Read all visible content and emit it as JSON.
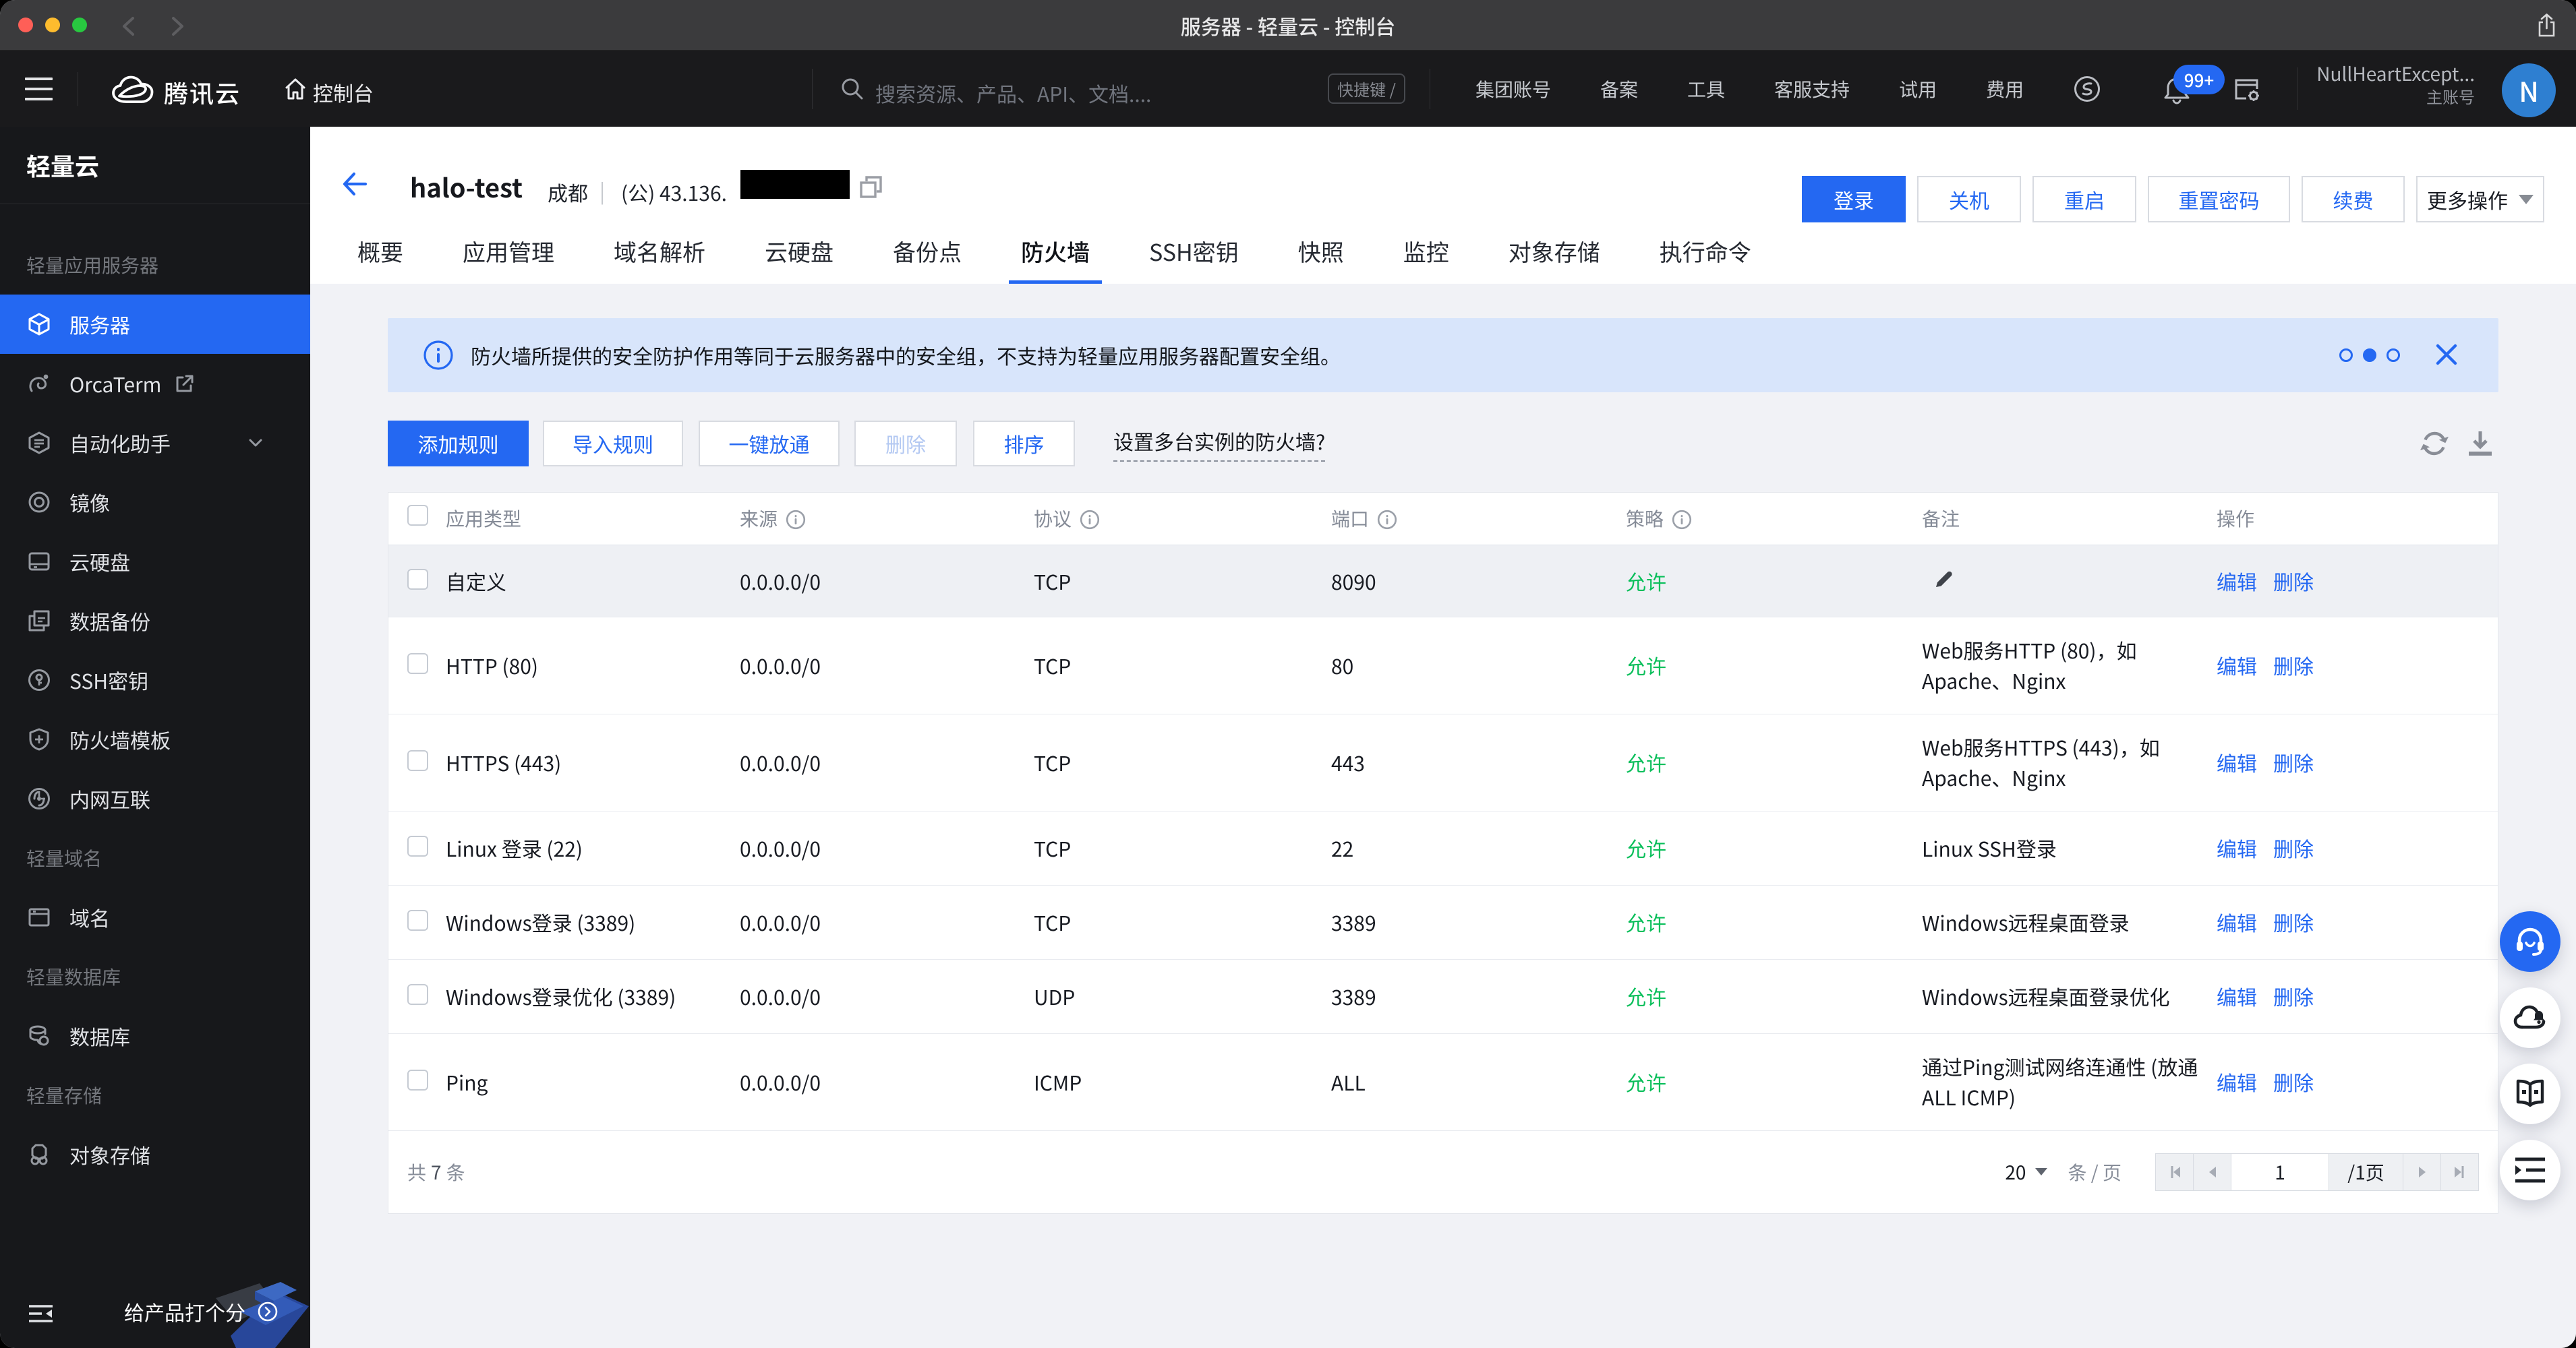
{
  "colors": {
    "accent_blue": "#2468f2",
    "success_green": "#0abf5b",
    "banner_bg": "#d8e5fb",
    "sidebar_bg": "#17181b",
    "navbar_bg": "#1a1a1c",
    "titlebar_bg": "#3b3b3d",
    "content_bg": "#f1f2f6",
    "avatar_bg": "#2e7fd1"
  },
  "titlebar": {
    "title": "服务器 - 轻量云 - 控制台"
  },
  "navbar": {
    "brand": "腾讯云",
    "console": "控制台",
    "search_placeholder": "搜索资源、产品、API、文档....",
    "shortcut_label": "快捷键 /",
    "items": [
      {
        "label": "集团账号"
      },
      {
        "label": "备案"
      },
      {
        "label": "工具"
      },
      {
        "label": "客服支持"
      },
      {
        "label": "试用"
      },
      {
        "label": "费用"
      }
    ],
    "notification_badge": "99+",
    "username": "NullHeartExcept...",
    "account_type": "主账号",
    "avatar_letter": "N"
  },
  "sidebar": {
    "title": "轻量云",
    "sections": [
      {
        "label": "轻量应用服务器",
        "items": [
          {
            "label": "服务器",
            "icon": "server-icon",
            "active": true
          },
          {
            "label": "OrcaTerm",
            "icon": "orcaterm-icon",
            "external": true
          },
          {
            "label": "自动化助手",
            "icon": "automation-icon",
            "chevron": true
          },
          {
            "label": "镜像",
            "icon": "image-icon"
          },
          {
            "label": "云硬盘",
            "icon": "clouddisk-icon"
          },
          {
            "label": "数据备份",
            "icon": "backup-icon"
          },
          {
            "label": "SSH密钥",
            "icon": "sshkey-icon"
          },
          {
            "label": "防火墙模板",
            "icon": "firewall-template-icon"
          },
          {
            "label": "内网互联",
            "icon": "intranet-icon"
          }
        ]
      },
      {
        "label": "轻量域名",
        "items": [
          {
            "label": "域名",
            "icon": "domain-icon"
          }
        ]
      },
      {
        "label": "轻量数据库",
        "items": [
          {
            "label": "数据库",
            "icon": "database-icon"
          }
        ]
      },
      {
        "label": "轻量存储",
        "items": [
          {
            "label": "对象存储",
            "icon": "storage-icon"
          }
        ]
      }
    ],
    "rate_label": "给产品打个分"
  },
  "header": {
    "instance_name": "halo-test",
    "region": "成都",
    "separator": "|",
    "ip_label": "(公) 43.136.",
    "actions": [
      {
        "label": "登录",
        "primary": true
      },
      {
        "label": "关机"
      },
      {
        "label": "重启"
      },
      {
        "label": "重置密码"
      },
      {
        "label": "续费"
      }
    ],
    "more_label": "更多操作"
  },
  "tabs": [
    {
      "label": "概要"
    },
    {
      "label": "应用管理"
    },
    {
      "label": "域名解析"
    },
    {
      "label": "云硬盘"
    },
    {
      "label": "备份点"
    },
    {
      "label": "防火墙",
      "active": true
    },
    {
      "label": "SSH密钥"
    },
    {
      "label": "快照"
    },
    {
      "label": "监控"
    },
    {
      "label": "对象存储"
    },
    {
      "label": "执行命令"
    }
  ],
  "banner": {
    "text": "防火墙所提供的安全防护作用等同于云服务器中的安全组，不支持为轻量应用服务器配置安全组。",
    "dots_active_index": 1,
    "dots_count": 3
  },
  "toolbar": {
    "add": "添加规则",
    "import": "导入规则",
    "open_all": "一键放通",
    "delete": "删除",
    "sort": "排序",
    "multi_link": "设置多台实例的防火墙?"
  },
  "table": {
    "columns": [
      {
        "label": "应用类型",
        "info": false
      },
      {
        "label": "来源",
        "info": true
      },
      {
        "label": "协议",
        "info": true
      },
      {
        "label": "端口",
        "info": true
      },
      {
        "label": "策略",
        "info": true
      },
      {
        "label": "备注",
        "info": false
      },
      {
        "label": "操作",
        "info": false
      }
    ],
    "edit_label": "编辑",
    "delete_label": "删除",
    "rows": [
      {
        "app": "自定义",
        "source": "0.0.0.0/0",
        "protocol": "TCP",
        "port": "8090",
        "policy": "允许",
        "remark": "",
        "remark_pencil": true,
        "highlight": true
      },
      {
        "app": "HTTP (80)",
        "source": "0.0.0.0/0",
        "protocol": "TCP",
        "port": "80",
        "policy": "允许",
        "remark": "Web服务HTTP (80)，如 Apache、Nginx",
        "tall": true
      },
      {
        "app": "HTTPS (443)",
        "source": "0.0.0.0/0",
        "protocol": "TCP",
        "port": "443",
        "policy": "允许",
        "remark": "Web服务HTTPS (443)，如 Apache、Nginx",
        "tall": true
      },
      {
        "app": "Linux 登录 (22)",
        "source": "0.0.0.0/0",
        "protocol": "TCP",
        "port": "22",
        "policy": "允许",
        "remark": "Linux SSH登录"
      },
      {
        "app": "Windows登录 (3389)",
        "source": "0.0.0.0/0",
        "protocol": "TCP",
        "port": "3389",
        "policy": "允许",
        "remark": "Windows远程桌面登录"
      },
      {
        "app": "Windows登录优化 (3389)",
        "source": "0.0.0.0/0",
        "protocol": "UDP",
        "port": "3389",
        "policy": "允许",
        "remark": "Windows远程桌面登录优化"
      },
      {
        "app": "Ping",
        "source": "0.0.0.0/0",
        "protocol": "ICMP",
        "port": "ALL",
        "policy": "允许",
        "remark": "通过Ping测试网络连通性 (放通 ALL ICMP)",
        "tall": true
      }
    ],
    "footer": {
      "total_prefix": "共",
      "total_count": "7",
      "total_suffix": "条",
      "page_size": "20",
      "per_page": "条 / 页",
      "current_page": "1",
      "total_pages": "/1页"
    }
  }
}
